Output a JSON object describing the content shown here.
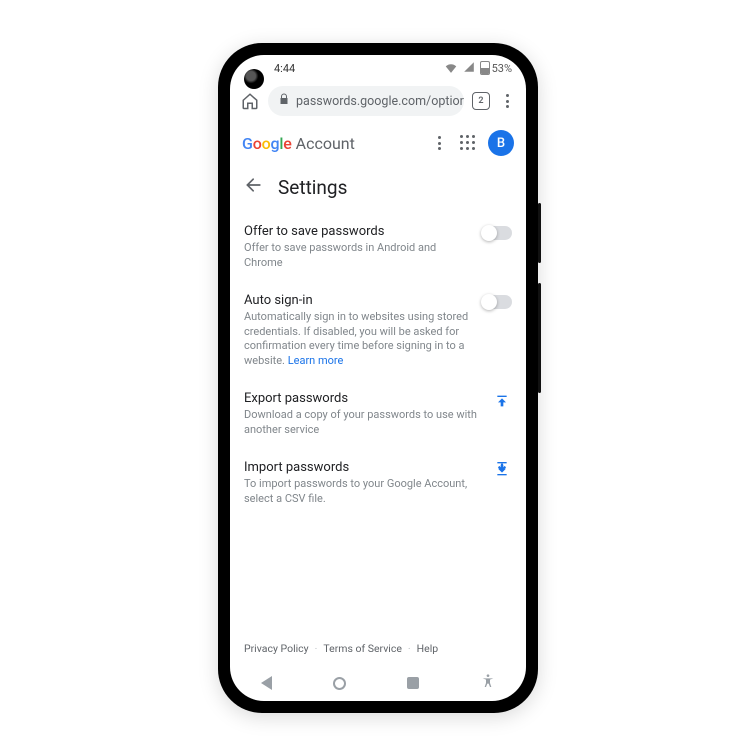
{
  "status": {
    "time": "4:44",
    "battery_pct": "53%"
  },
  "browser": {
    "url": "passwords.google.com/options",
    "tab_count": "2"
  },
  "appbar": {
    "brand_account": "Account",
    "avatar_initial": "B"
  },
  "page": {
    "title": "Settings"
  },
  "settings": {
    "offer_save": {
      "title": "Offer to save passwords",
      "desc": "Offer to save passwords in Android and Chrome"
    },
    "auto_signin": {
      "title": "Auto sign-in",
      "desc": "Automatically sign in to websites using stored credentials. If disabled, you will be asked for confirmation every time before signing in to a website. ",
      "learn_more": "Learn more"
    },
    "export": {
      "title": "Export passwords",
      "desc": "Download a copy of your passwords to use with another service"
    },
    "import": {
      "title": "Import passwords",
      "desc": "To import passwords to your Google Account, select a CSV file."
    }
  },
  "footer": {
    "privacy": "Privacy Policy",
    "tos": "Terms of Service",
    "help": "Help"
  }
}
